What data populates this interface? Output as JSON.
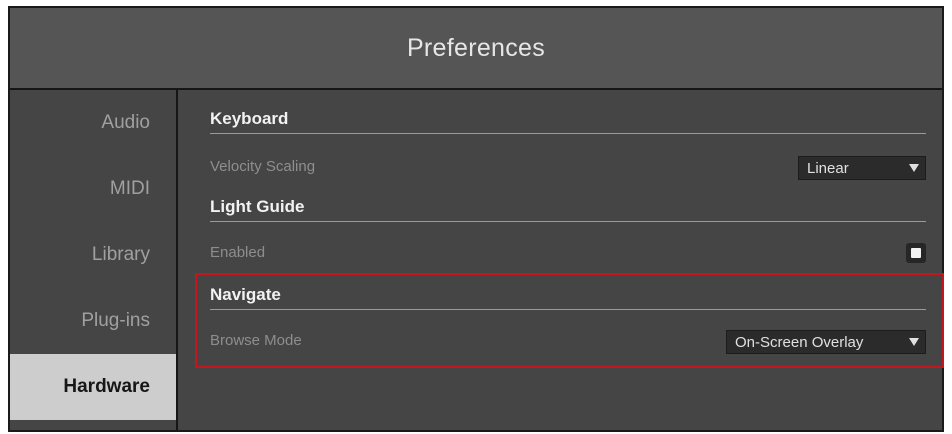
{
  "window": {
    "title": "Preferences"
  },
  "sidebar": {
    "items": [
      {
        "label": "Audio",
        "active": false
      },
      {
        "label": "MIDI",
        "active": false
      },
      {
        "label": "Library",
        "active": false
      },
      {
        "label": "Plug-ins",
        "active": false
      },
      {
        "label": "Hardware",
        "active": true
      }
    ]
  },
  "sections": {
    "keyboard": {
      "title": "Keyboard",
      "velocity_label": "Velocity Scaling",
      "velocity_value": "Linear"
    },
    "light_guide": {
      "title": "Light Guide",
      "enabled_label": "Enabled",
      "enabled_checked": true
    },
    "navigate": {
      "title": "Navigate",
      "browse_mode_label": "Browse Mode",
      "browse_mode_value": "On-Screen Overlay"
    }
  },
  "annotation": {
    "highlight_color": "#c4161c",
    "highlighted_section": "navigate"
  },
  "colors": {
    "background": "#454545",
    "title_bar": "#555555",
    "active_tab": "#cdcdcd"
  }
}
